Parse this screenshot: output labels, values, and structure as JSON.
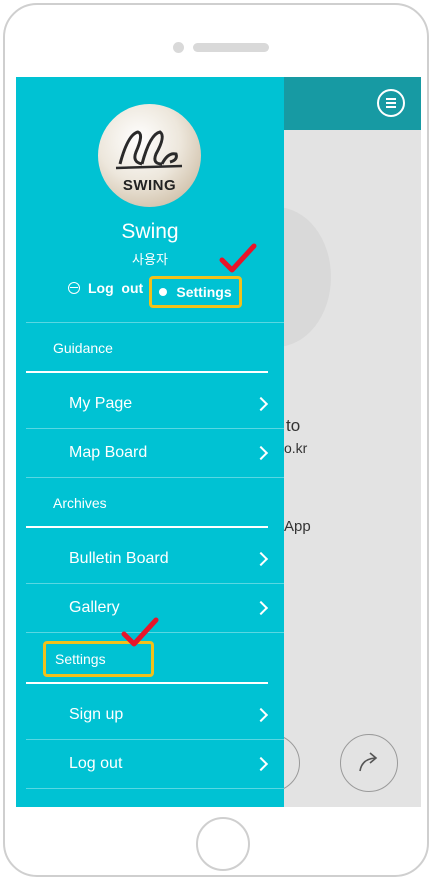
{
  "drawer": {
    "profile": {
      "avatar_logo_text": "SWING",
      "name": "Swing",
      "role": "사용자"
    },
    "quick_actions": {
      "logout_label": "Log  out",
      "settings_label": "Settings"
    },
    "sections": [
      {
        "title": "Guidance",
        "items": [
          {
            "label": "My Page"
          },
          {
            "label": "Map Board"
          }
        ]
      },
      {
        "title": "Archives",
        "items": [
          {
            "label": "Bulletin Board"
          },
          {
            "label": "Gallery"
          }
        ]
      },
      {
        "title": "Settings",
        "items": [
          {
            "label": "Sign up"
          },
          {
            "label": "Log out"
          }
        ]
      }
    ],
    "icons": {
      "logout": "logout-icon",
      "settings": "settings-gear-icon",
      "chevron": "chevron-right-icon",
      "annotation": "red-checkmark-icon"
    }
  },
  "background_app": {
    "menu_icon": "hamburger-menu-icon",
    "text_fragments": [
      "to",
      "o.kr",
      "App"
    ],
    "share_icon": "share-arrow-icon"
  },
  "colors": {
    "drawer_bg": "#00c2d3",
    "topbar_bg": "#179aa3",
    "highlight_box": "#f2c11a",
    "annotation_check": "#e8142a"
  }
}
